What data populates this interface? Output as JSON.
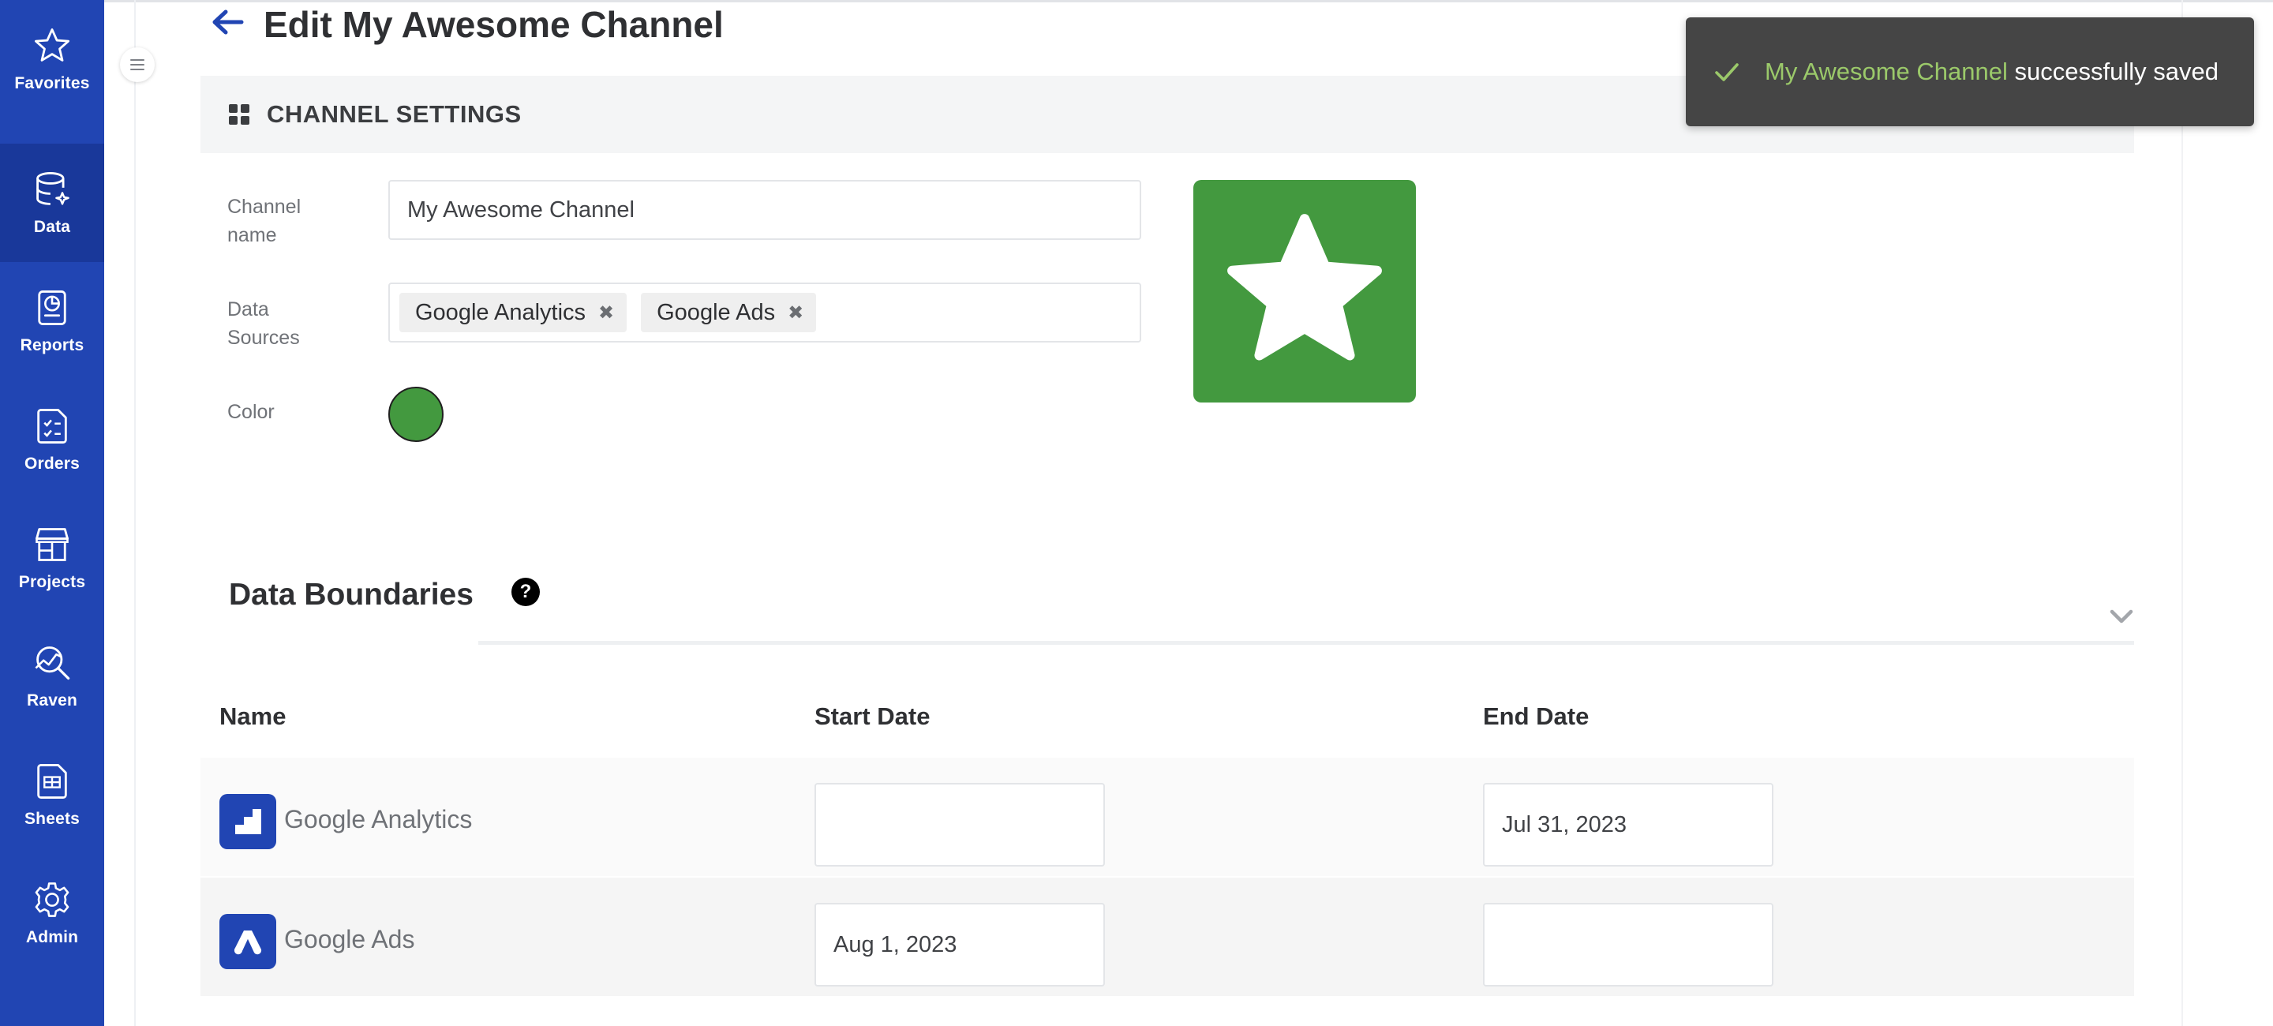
{
  "colors": {
    "sidebar_bg": "#2145b3",
    "sidebar_active": "#19389a",
    "channel_color": "#43993f",
    "toast_bg": "#454545",
    "toast_highlight": "#9bc96a"
  },
  "sidebar": {
    "items": [
      {
        "label": "Favorites",
        "icon": "star-outline-icon",
        "active": false
      },
      {
        "label": "Data",
        "icon": "database-icon",
        "active": true
      },
      {
        "label": "Reports",
        "icon": "report-chart-icon",
        "active": false
      },
      {
        "label": "Orders",
        "icon": "checklist-icon",
        "active": false
      },
      {
        "label": "Projects",
        "icon": "storefront-icon",
        "active": false
      },
      {
        "label": "Raven",
        "icon": "search-trend-icon",
        "active": false
      },
      {
        "label": "Sheets",
        "icon": "spreadsheet-icon",
        "active": false
      },
      {
        "label": "Admin",
        "icon": "gear-icon",
        "active": false
      }
    ]
  },
  "header": {
    "title": "Edit My Awesome Channel"
  },
  "settings": {
    "section_title": "CHANNEL SETTINGS",
    "channel_name_label": "Channel name",
    "channel_name_value": "My Awesome Channel",
    "data_sources_label": "Data Sources",
    "data_sources": [
      "Google Analytics",
      "Google Ads"
    ],
    "color_label": "Color",
    "preview_icon": "star-icon"
  },
  "boundaries": {
    "title": "Data Boundaries",
    "help_glyph": "?",
    "columns": [
      "Name",
      "Start Date",
      "End Date"
    ],
    "rows": [
      {
        "name": "Google Analytics",
        "logo": "google-analytics-icon",
        "start_date": "",
        "end_date": "Jul 31, 2023"
      },
      {
        "name": "Google Ads",
        "logo": "google-ads-icon",
        "start_date": "Aug 1, 2023",
        "end_date": ""
      }
    ]
  },
  "toast": {
    "channel_name": "My Awesome Channel",
    "message": " successfully saved"
  }
}
